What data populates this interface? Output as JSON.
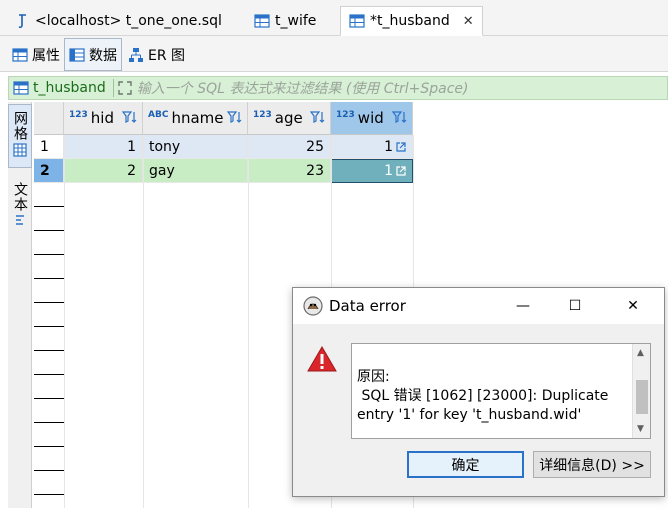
{
  "editor_tabs": [
    {
      "label": "<localhost> t_one_one.sql",
      "icon": "sql-script-icon"
    },
    {
      "label": "t_wife",
      "icon": "table-icon"
    },
    {
      "label": "*t_husband",
      "icon": "table-icon",
      "active": true,
      "close": "✕"
    }
  ],
  "sub_tabs": [
    {
      "label": "属性",
      "icon": "properties-icon"
    },
    {
      "label": "数据",
      "icon": "data-icon",
      "active": true
    },
    {
      "label": "ER 图",
      "icon": "er-diagram-icon"
    }
  ],
  "filter": {
    "table_name": "t_husband",
    "placeholder": "输入一个 SQL 表达式来过滤结果 (使用 Ctrl+Space)"
  },
  "side_tabs": [
    {
      "label": "网格",
      "icon": "grid-icon",
      "active": true
    },
    {
      "label": "文本",
      "icon": "text-icon"
    }
  ],
  "grid": {
    "columns": [
      {
        "name": "hid",
        "type_badge": "123"
      },
      {
        "name": "hname",
        "type_badge": "ABC"
      },
      {
        "name": "age",
        "type_badge": "123"
      },
      {
        "name": "wid",
        "type_badge": "123",
        "selected": true
      }
    ],
    "rows": [
      {
        "num": "1",
        "hid": "1",
        "hname": "tony",
        "age": "25",
        "wid": "1"
      },
      {
        "num": "2",
        "hid": "2",
        "hname": "gay",
        "age": "23",
        "wid": "1"
      }
    ]
  },
  "dialog": {
    "title": "Data error",
    "message": "原因:\n SQL 错误 [1062] [23000]: Duplicate entry '1' for key 't_husband.wid'",
    "ok_label": "确定",
    "details_label": "详细信息(D) >>",
    "minimize": "—",
    "maximize": "☐",
    "close": "✕"
  },
  "colors": {
    "accent": "#2a72c8",
    "filter_bg": "#d8f0d6",
    "selected_header": "#9ec7ea",
    "error_red": "#d9262b"
  }
}
